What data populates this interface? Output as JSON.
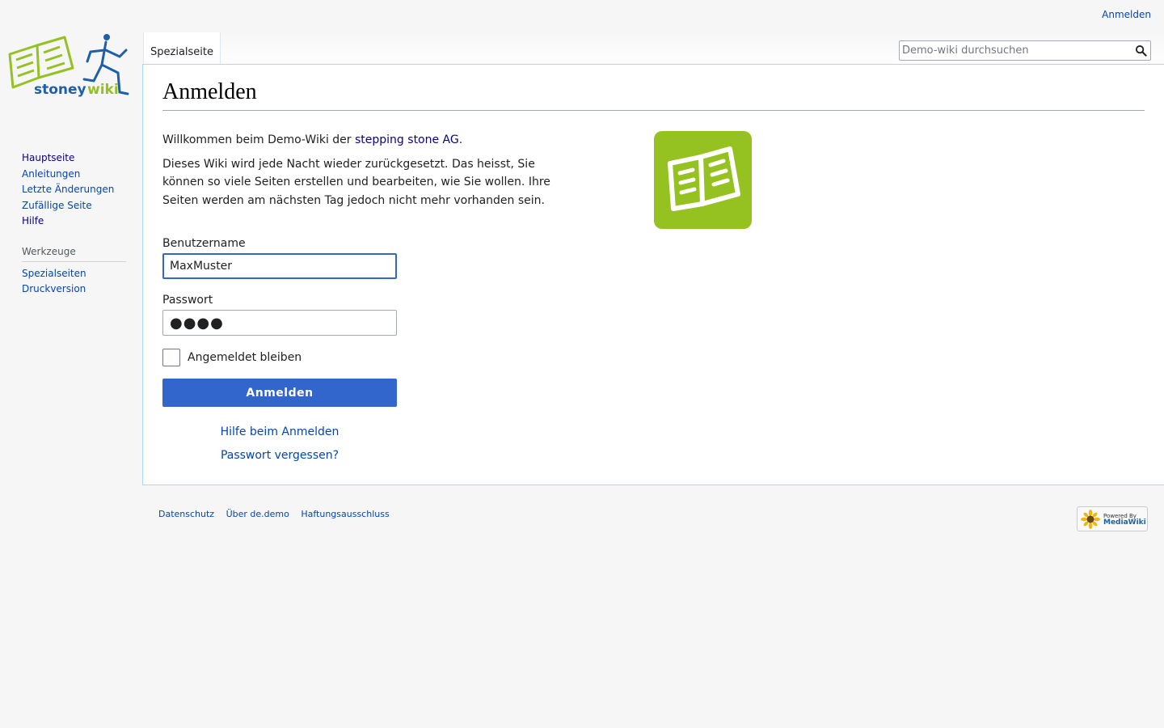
{
  "personal_tools": {
    "login_link": "Anmelden"
  },
  "logo": {
    "text_stoney": "stoney",
    "text_wiki": "wiki",
    "alt": "stoneywiki"
  },
  "sidebar": {
    "navigation": [
      {
        "label": "Hauptseite"
      },
      {
        "label": "Anleitungen"
      },
      {
        "label": "Letzte Änderungen"
      },
      {
        "label": "Zufällige Seite"
      },
      {
        "label": "Hilfe"
      }
    ],
    "tools_heading": "Werkzeuge",
    "tools": [
      {
        "label": "Spezialseiten"
      },
      {
        "label": "Druckversion"
      }
    ]
  },
  "tabs": {
    "active": "Spezialseite"
  },
  "search": {
    "placeholder": "Demo-wiki durchsuchen",
    "value": "",
    "icon": "search-icon"
  },
  "page": {
    "title": "Anmelden",
    "intro_prefix": "Willkommen beim Demo-Wiki der ",
    "intro_link": "stepping stone AG",
    "intro_suffix": ".",
    "intro_text": "Dieses Wiki wird jede Nacht wieder zurückgesetzt. Das heisst, Sie können so viele Seiten erstellen und bearbeiten, wie Sie wollen. Ihre Seiten werden am nächsten Tag jedoch nicht mehr vorhanden sein.",
    "book_icon": "open-book-icon"
  },
  "form": {
    "username_label": "Benutzername",
    "username_value": "MaxMuster",
    "password_label": "Passwort",
    "password_masked": "●●●●",
    "remember_label": "Angemeldet bleiben",
    "remember_checked": false,
    "submit_label": "Anmelden",
    "help_link": "Hilfe beim Anmelden",
    "forgot_link": "Passwort vergessen?"
  },
  "footer": {
    "links": [
      "Datenschutz",
      "Über de.demo",
      "Haftungsausschluss"
    ],
    "powered_by_line": "Powered By",
    "powered_by_name": "MediaWiki"
  },
  "colors": {
    "link": "#0645ad",
    "visited_link": "#0b0080",
    "accent": "#3366cc",
    "logo_green": "#95c121",
    "logo_blue": "#1f5fa8"
  }
}
